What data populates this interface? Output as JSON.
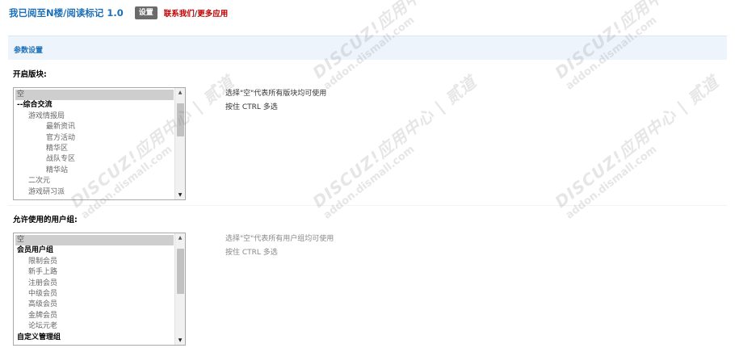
{
  "header": {
    "app_title": "我已阅至N楼/阅读标记 1.0",
    "settings_button": "设置",
    "contact_link": "联系我们",
    "separator": "/",
    "more_apps_link": "更多应用"
  },
  "section": {
    "title": "参数设置"
  },
  "forums_field": {
    "label": "开启版块:",
    "options": [
      {
        "text": "空",
        "selected": true,
        "group": false,
        "level": 0
      },
      {
        "text": "--综合交流",
        "selected": false,
        "group": true,
        "level": 0
      },
      {
        "text": "游戏情报局",
        "selected": false,
        "group": false,
        "level": 1
      },
      {
        "text": "最新资讯",
        "selected": false,
        "group": false,
        "level": 2
      },
      {
        "text": "官方活动",
        "selected": false,
        "group": false,
        "level": 2
      },
      {
        "text": "精华区",
        "selected": false,
        "group": false,
        "level": 2
      },
      {
        "text": "战队专区",
        "selected": false,
        "group": false,
        "level": 2
      },
      {
        "text": "精华站",
        "selected": false,
        "group": false,
        "level": 2
      },
      {
        "text": "二次元",
        "selected": false,
        "group": false,
        "level": 1
      },
      {
        "text": "游戏研习派",
        "selected": false,
        "group": false,
        "level": 1
      }
    ],
    "scroll_position": 0.0,
    "visible_fraction": 0.35,
    "hint_line1": "选择\"空\"代表所有版块均可使用",
    "hint_line2": "按住 CTRL 多选"
  },
  "groups_field": {
    "label": "允许使用的用户组:",
    "options": [
      {
        "text": "空",
        "selected": true,
        "group": false,
        "level": 0
      },
      {
        "text": "会员用户组",
        "selected": false,
        "group": true,
        "level": 0
      },
      {
        "text": "限制会员",
        "selected": false,
        "group": false,
        "level": 1
      },
      {
        "text": "新手上路",
        "selected": false,
        "group": false,
        "level": 1
      },
      {
        "text": "注册会员",
        "selected": false,
        "group": false,
        "level": 1
      },
      {
        "text": "中级会员",
        "selected": false,
        "group": false,
        "level": 1
      },
      {
        "text": "高级会员",
        "selected": false,
        "group": false,
        "level": 1
      },
      {
        "text": "金牌会员",
        "selected": false,
        "group": false,
        "level": 1
      },
      {
        "text": "论坛元老",
        "selected": false,
        "group": false,
        "level": 1
      },
      {
        "text": "自定义管理组",
        "selected": false,
        "group": true,
        "level": 0
      }
    ],
    "scroll_position": 0.0,
    "visible_fraction": 0.48,
    "hint_line1": "选择\"空\"代表所有用户组均可使用",
    "hint_line2": "按住 CTRL 多选"
  },
  "watermark": {
    "line1": "DISCUZ!应用中心 | 贰道",
    "line2": "addon.dismall.com"
  },
  "colors": {
    "title_blue": "#1d6fb8",
    "link_red": "#c00000",
    "header_bg": "#eef4fb",
    "button_gray": "#6b6b6b"
  }
}
